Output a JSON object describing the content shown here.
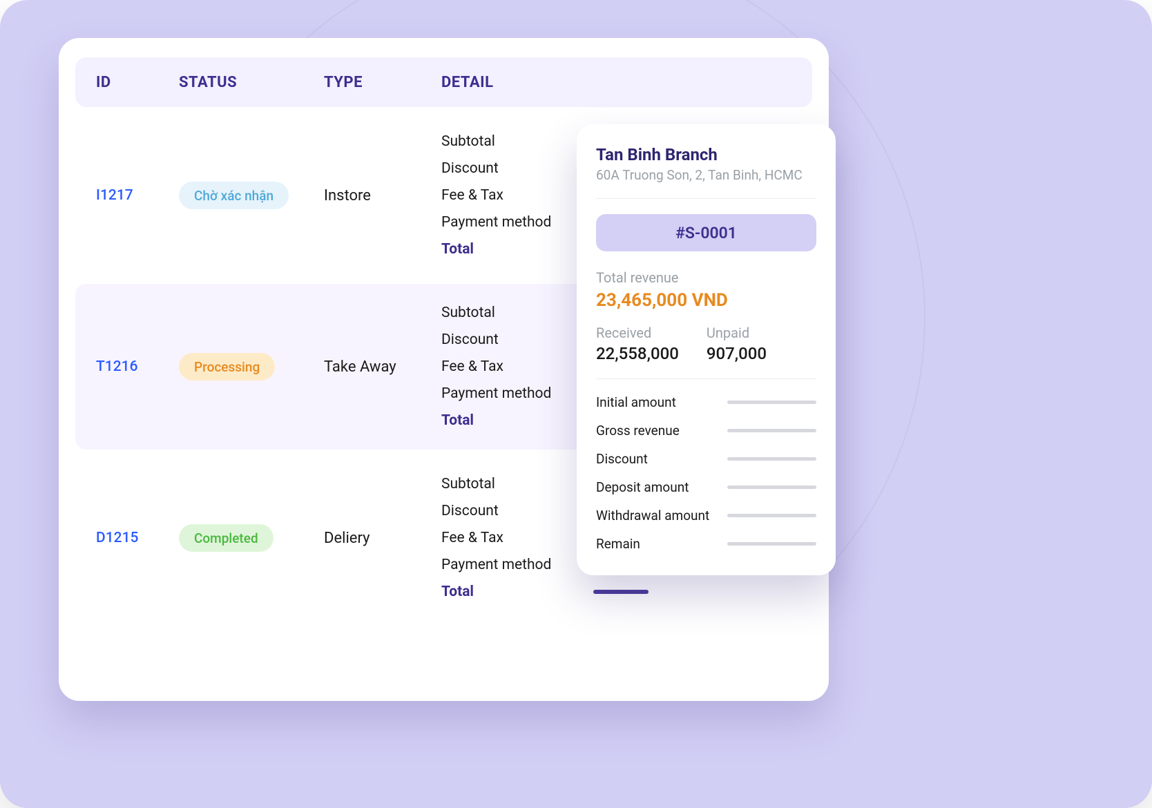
{
  "table": {
    "headers": {
      "id": "ID",
      "status": "STATUS",
      "type": "TYPE",
      "detail": "DETAIL"
    },
    "detail_labels": {
      "subtotal": "Subtotal",
      "discount": "Discount",
      "feetax": "Fee & Tax",
      "payment": "Payment method",
      "total": "Total"
    },
    "rows": [
      {
        "id": "I1217",
        "status_label": "Chờ xác nhận",
        "status_kind": "pending",
        "type": "Instore",
        "highlight": false
      },
      {
        "id": "T1216",
        "status_label": "Processing",
        "status_kind": "processing",
        "type": "Take Away",
        "highlight": true
      },
      {
        "id": "D1215",
        "status_label": "Completed",
        "status_kind": "completed",
        "type": "Deliery",
        "highlight": false
      }
    ]
  },
  "summary": {
    "branch_name": "Tan Binh Branch",
    "branch_address": "60A Truong Son, 2, Tan Binh, HCMC",
    "session_id": "#S-0001",
    "revenue": {
      "label": "Total revenue",
      "value": "23,465,000 VND"
    },
    "received": {
      "label": "Received",
      "value": "22,558,000"
    },
    "unpaid": {
      "label": "Unpaid",
      "value": "907,000"
    },
    "metrics": [
      "Initial amount",
      "Gross revenue",
      "Discount",
      "Deposit amount",
      "Withdrawal amount",
      "Remain"
    ]
  }
}
